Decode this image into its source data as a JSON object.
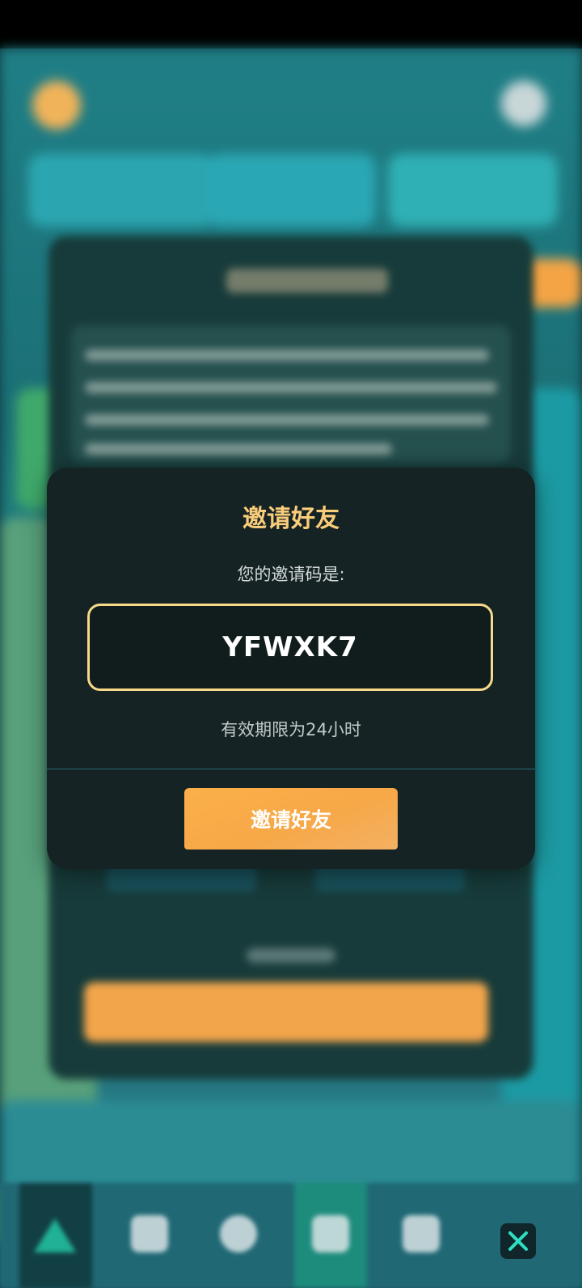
{
  "modal": {
    "title": "邀请好友",
    "subtitle": "您的邀请码是:",
    "invite_code": "YFWXK7",
    "validity": "有效期限为24小时",
    "invite_button_label": "邀请好友"
  },
  "colors": {
    "modal_bg": "#152324",
    "title_gold": "#f9cd7a",
    "code_border": "#f7d98a",
    "button_orange": "#f7a847",
    "divider": "#2a6d78"
  },
  "icons": {
    "close": "close-icon",
    "nav_home": "triangle-home-icon"
  }
}
